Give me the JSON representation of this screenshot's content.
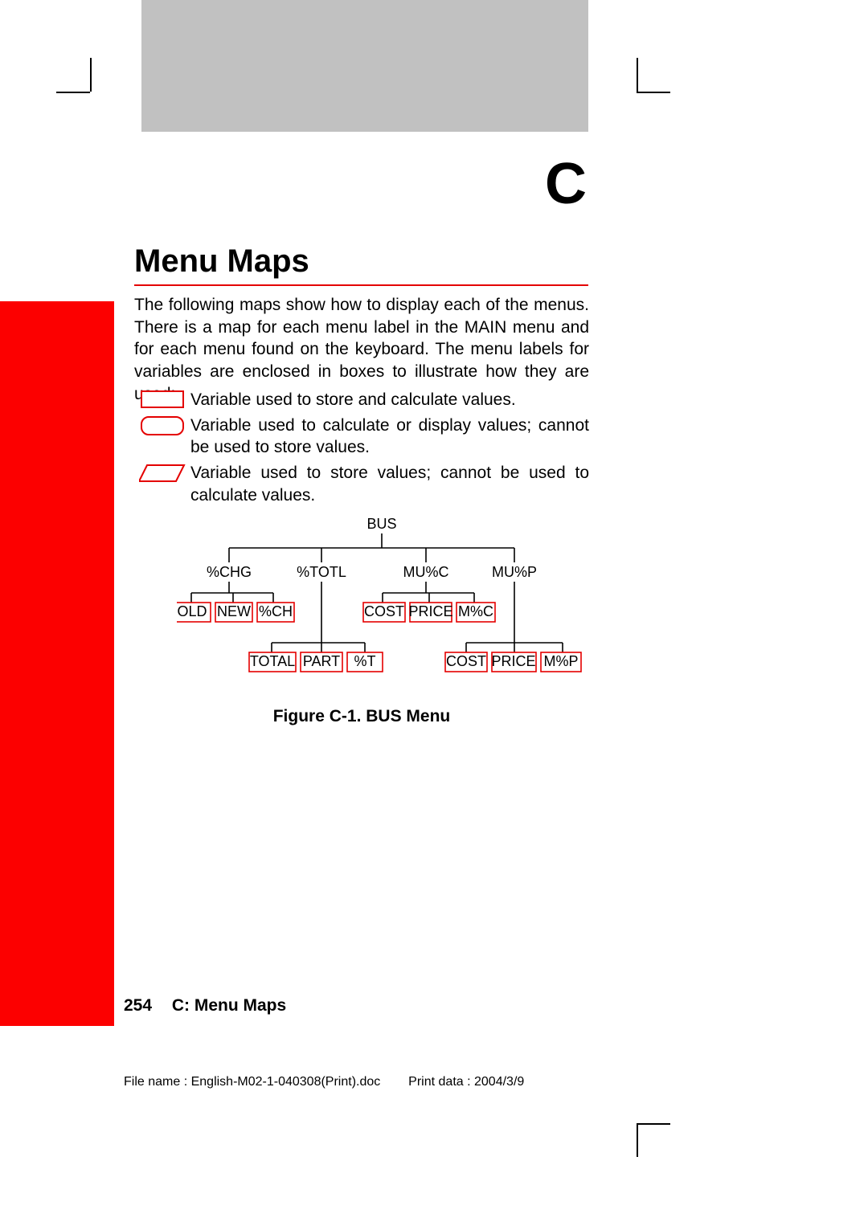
{
  "chapter": "C",
  "title": "Menu Maps",
  "intro": "The following maps show how to display each of the menus. There is a map for each menu label in the MAIN menu and for each menu found on the keyboard. The menu labels for variables are enclosed in boxes to illustrate how they are used:",
  "legend": {
    "rect": "Variable used to store and calculate values.",
    "round": "Variable used to calculate or display values; cannot be used to store values.",
    "para": "Variable used to store values; cannot be used to calculate values."
  },
  "diagram": {
    "root": "BUS",
    "level1": [
      "%CHG",
      "%TOTL",
      "MU%C",
      "MU%P"
    ],
    "row2": [
      "OLD",
      "NEW",
      "%CH",
      "COST",
      "PRICE",
      "M%C"
    ],
    "row3": [
      "TOTAL",
      "PART",
      "%T",
      "COST",
      "PRICE",
      "M%P"
    ]
  },
  "caption": "Figure C-1. BUS Menu",
  "footer": {
    "page": "254",
    "label": "C: Menu Maps"
  },
  "meta": {
    "filename_label": "File name :",
    "filename": "English-M02-1-040308(Print).doc",
    "printdata_label": "Print data :",
    "printdata": "2004/3/9"
  }
}
